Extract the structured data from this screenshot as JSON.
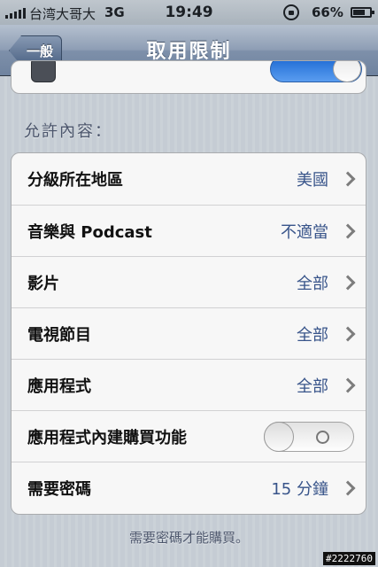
{
  "status_bar": {
    "carrier": "台湾大哥大",
    "network": "3G",
    "time": "19:49",
    "battery": "66%"
  },
  "nav": {
    "back_label": "一般",
    "title": "取用限制"
  },
  "section_header": "允許內容：",
  "rows": [
    {
      "label": "分級所在地區",
      "value": "美國"
    },
    {
      "label": "音樂與 Podcast",
      "value": "不適當"
    },
    {
      "label": "影片",
      "value": "全部"
    },
    {
      "label": "電視節目",
      "value": "全部"
    },
    {
      "label": "應用程式",
      "value": "全部"
    },
    {
      "label": "應用程式內建購買功能",
      "toggle": "off"
    },
    {
      "label": "需要密碼",
      "value": "15 分鐘"
    }
  ],
  "footer_note": "需要密碼才能購買。",
  "watermark": "#2222760",
  "colors": {
    "value_text": "#38548a",
    "nav_bar": "#7e90aa",
    "toggle_on": "#1b68d2",
    "background": "#c5ccd4"
  },
  "top_row_partial": {
    "switch_state": "on"
  }
}
